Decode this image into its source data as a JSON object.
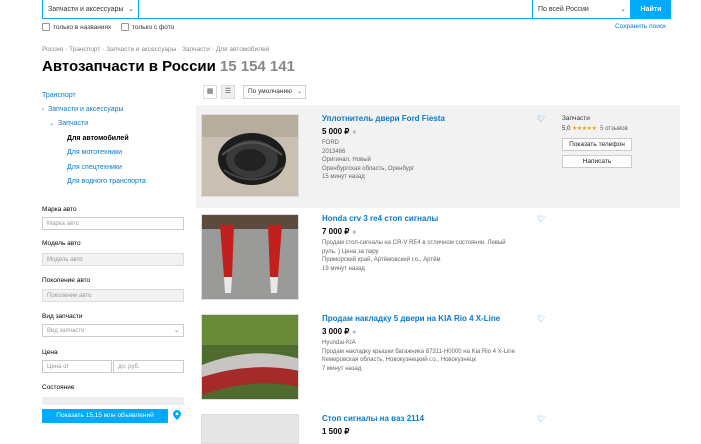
{
  "search": {
    "category_value": "Запчасти и аксессуары",
    "region_value": "По всей России",
    "find_label": "Найти",
    "only_in_titles_label": "только в названиях",
    "only_with_photo_label": "только с фото",
    "save_search_label": "Сохранить поиск"
  },
  "breadcrumbs": [
    "Россия",
    "Транспорт",
    "Запчасти и аксессуары",
    "Запчасти",
    "Для автомобилей"
  ],
  "breadcrumb_sep": "·",
  "page": {
    "title": "Автозапчасти в России",
    "count": "15 154 141"
  },
  "sidebar": {
    "transport": "Транспорт",
    "parts_and_accessories": "Запчасти и аксессуары",
    "parts": "Запчасти",
    "for_cars": "Для автомобилей",
    "for_motorcycles": "Для мототехники",
    "for_special": "Для спецтехники",
    "for_water": "Для водного транспорта"
  },
  "filters": {
    "brand_label": "Марка авто",
    "brand_placeholder": "Марка авто",
    "model_label": "Модель авто",
    "model_placeholder": "Модель авто",
    "generation_label": "Поколение авто",
    "generation_placeholder": "Поколение авто",
    "parts_type_label": "Вид запчасти",
    "parts_type_placeholder": "Вид запчасти",
    "price_label": "Цена",
    "price_from_placeholder": "Цена от",
    "price_to_placeholder": "до, руб.",
    "condition_label": "Состояние",
    "show_button": "Показать 15,15 млн объявлений"
  },
  "sort": {
    "value": "По умолчанию"
  },
  "listings": [
    {
      "title": "Уплотнитель двери Ford Fiesta",
      "price": "5 000 ₽",
      "meta": [
        "FORD",
        "2013466",
        "Оригинал. Новый",
        "Оренбургская область, Оренбург",
        "15 минут назад"
      ]
    },
    {
      "title": "Honda crv 3 re4 стоп сигналы",
      "price": "7 000 ₽",
      "meta": [
        "Продам стоп-сигналы на CR-V RE4 в отличном состоянии. Левый",
        "руль. ) Цена за пару",
        "Приморский край, Артёмовский г.о., Артём",
        "19 минут назад"
      ]
    },
    {
      "title": "Продам накладку 5 двери на KIA Rio 4 X-Line",
      "price": "3 000 ₽",
      "meta": [
        "Hyundai-KIA",
        "Продам накладку крышки багажника 87311-H0000 на Kia Rio 4 X-Line",
        "Кемеровская область, Новокузнецкий г.о., Новокузнецк",
        "7 минут назад"
      ]
    },
    {
      "title": "Стоп сигналы на ваз 2114",
      "price": "1 500 ₽",
      "meta": []
    }
  ],
  "seller": {
    "category": "Запчасти",
    "rating": "5,0",
    "stars": "★★★★★",
    "reviews": "5 отзывов",
    "show_phone": "Показать телефон",
    "write": "Написать"
  },
  "colors": {
    "accent": "#00aaff",
    "link": "#0a7acc"
  }
}
